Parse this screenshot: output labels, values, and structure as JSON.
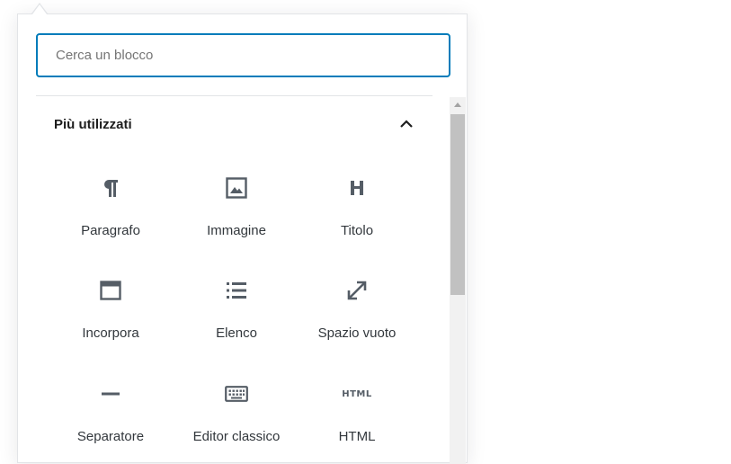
{
  "inserter": {
    "search": {
      "placeholder": "Cerca un blocco",
      "value": ""
    },
    "section": {
      "title": "Più utilizzati",
      "toggle_icon": "chevron-up-icon"
    },
    "blocks": [
      {
        "label": "Paragrafo",
        "icon": "paragraph-icon"
      },
      {
        "label": "Immagine",
        "icon": "image-icon"
      },
      {
        "label": "Titolo",
        "icon": "heading-icon"
      },
      {
        "label": "Incorpora",
        "icon": "embed-icon"
      },
      {
        "label": "Elenco",
        "icon": "list-icon"
      },
      {
        "label": "Spazio vuoto",
        "icon": "spacer-icon"
      },
      {
        "label": "Separatore",
        "icon": "separator-icon"
      },
      {
        "label": "Editor classico",
        "icon": "keyboard-icon"
      },
      {
        "label": "HTML",
        "icon": "html-icon",
        "icon_text": "HTML"
      }
    ]
  },
  "colors": {
    "accent": "#007cba",
    "icon": "#555d66",
    "text": "#32373c",
    "border": "#e2e4e7"
  }
}
